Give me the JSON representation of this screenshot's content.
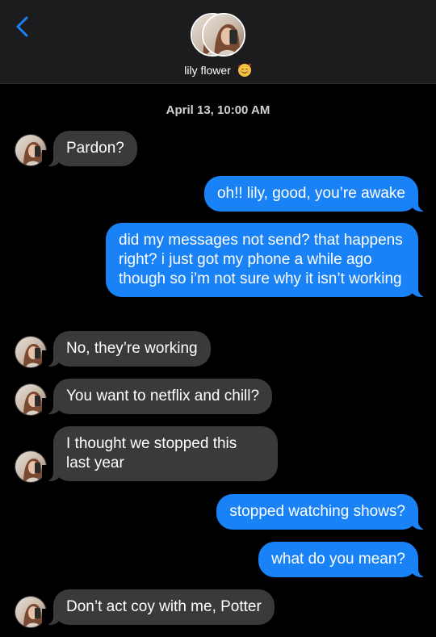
{
  "header": {
    "contact_name": "lily flower",
    "contact_emoji": "smiling-face-with-hearts"
  },
  "timestamp": "April 13, 10:00 AM",
  "messages": [
    {
      "dir": "in",
      "text": "Pardon?"
    },
    {
      "dir": "out",
      "text": "oh!! lily, good, you’re awake"
    },
    {
      "dir": "out",
      "text": "did my messages not send? that happens right? i just got my phone a while ago though so i’m not sure why it isn’t working"
    },
    {
      "dir": "in",
      "text": "No, they’re working"
    },
    {
      "dir": "in",
      "text": "You want to netflix and chill?"
    },
    {
      "dir": "in",
      "text": "I thought we stopped this last year"
    },
    {
      "dir": "out",
      "text": "stopped watching shows?"
    },
    {
      "dir": "out",
      "text": "what do you mean?"
    },
    {
      "dir": "in",
      "text": "Don’t act coy with me, Potter"
    }
  ],
  "colors": {
    "incoming_bubble": "#3a3a3c",
    "outgoing_bubble": "#1a82f7",
    "back_chevron": "#1a82f7",
    "header_bg": "#1c1c1e"
  }
}
